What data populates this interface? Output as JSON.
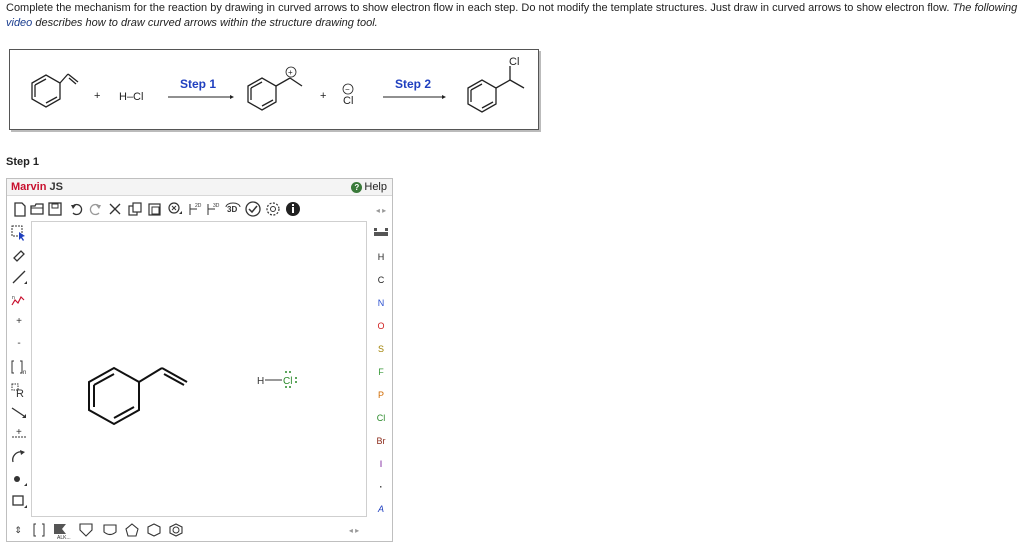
{
  "instructions": {
    "text1": "Complete the mechanism for the reaction by drawing in curved arrows to show electron flow in each step. Do not modify the template structures. Just draw in curved arrows to show electron flow.",
    "text2_prefix": "The following ",
    "video_link": "video",
    "text2_suffix": " describes how to draw curved arrows within the structure drawing tool."
  },
  "scheme": {
    "plus1": "+",
    "reagent": "H–Cl",
    "step1_label": "Step 1",
    "plus2": "+",
    "chloride": "Cl",
    "chloride_charge": "−",
    "carbocation_charge": "+",
    "step2_label": "Step 2",
    "product_cl": "Cl",
    "step1_color": "#1f3fbf",
    "step2_color": "#1f3fbf"
  },
  "step_heading": "Step 1",
  "marvin": {
    "logo_brand": "Marvin",
    "logo_suffix": " JS",
    "help_label": "Help",
    "top_toolbar_icons": [
      "new-document-icon",
      "open-icon",
      "save-icon",
      "undo-icon",
      "redo-icon",
      "cut-icon",
      "copy-icon",
      "paste-icon",
      "zoom-icon",
      "clean-2d-icon",
      "clean-3d-icon",
      "3d-rotate-icon",
      "check-icon",
      "settings-icon",
      "info-icon"
    ],
    "left_toolbar_icons": [
      "select-icon",
      "erase-icon",
      "single-bond-icon",
      "chain-icon",
      "increase-charge-icon",
      "decrease-charge-icon",
      "bracket-icon",
      "r-group-icon",
      "reaction-arrow-icon",
      "mapping-icon",
      "curved-arrow-icon",
      "lone-pair-icon",
      "rectangle-icon"
    ],
    "elements": [
      "H",
      "C",
      "N",
      "O",
      "S",
      "F",
      "P",
      "Cl",
      "Br",
      "I"
    ],
    "element_colors": {
      "H": "#444444",
      "C": "#444444",
      "N": "#2a4fcf",
      "O": "#d02020",
      "S": "#a08000",
      "F": "#3a9a3a",
      "P": "#d06a00",
      "Cl": "#2a8a2a",
      "Br": "#8a2a1a",
      "I": "#7a1a9a"
    },
    "atom_list_label": "A",
    "periodic_table_label": "periodic-table-icon",
    "bottom_template_label": "ALK...",
    "canvas": {
      "h_label": "H",
      "cl_label": "Cl",
      "cl_color": "#2a8a2a",
      "lone_pair_color": "#2a8a2a"
    }
  }
}
